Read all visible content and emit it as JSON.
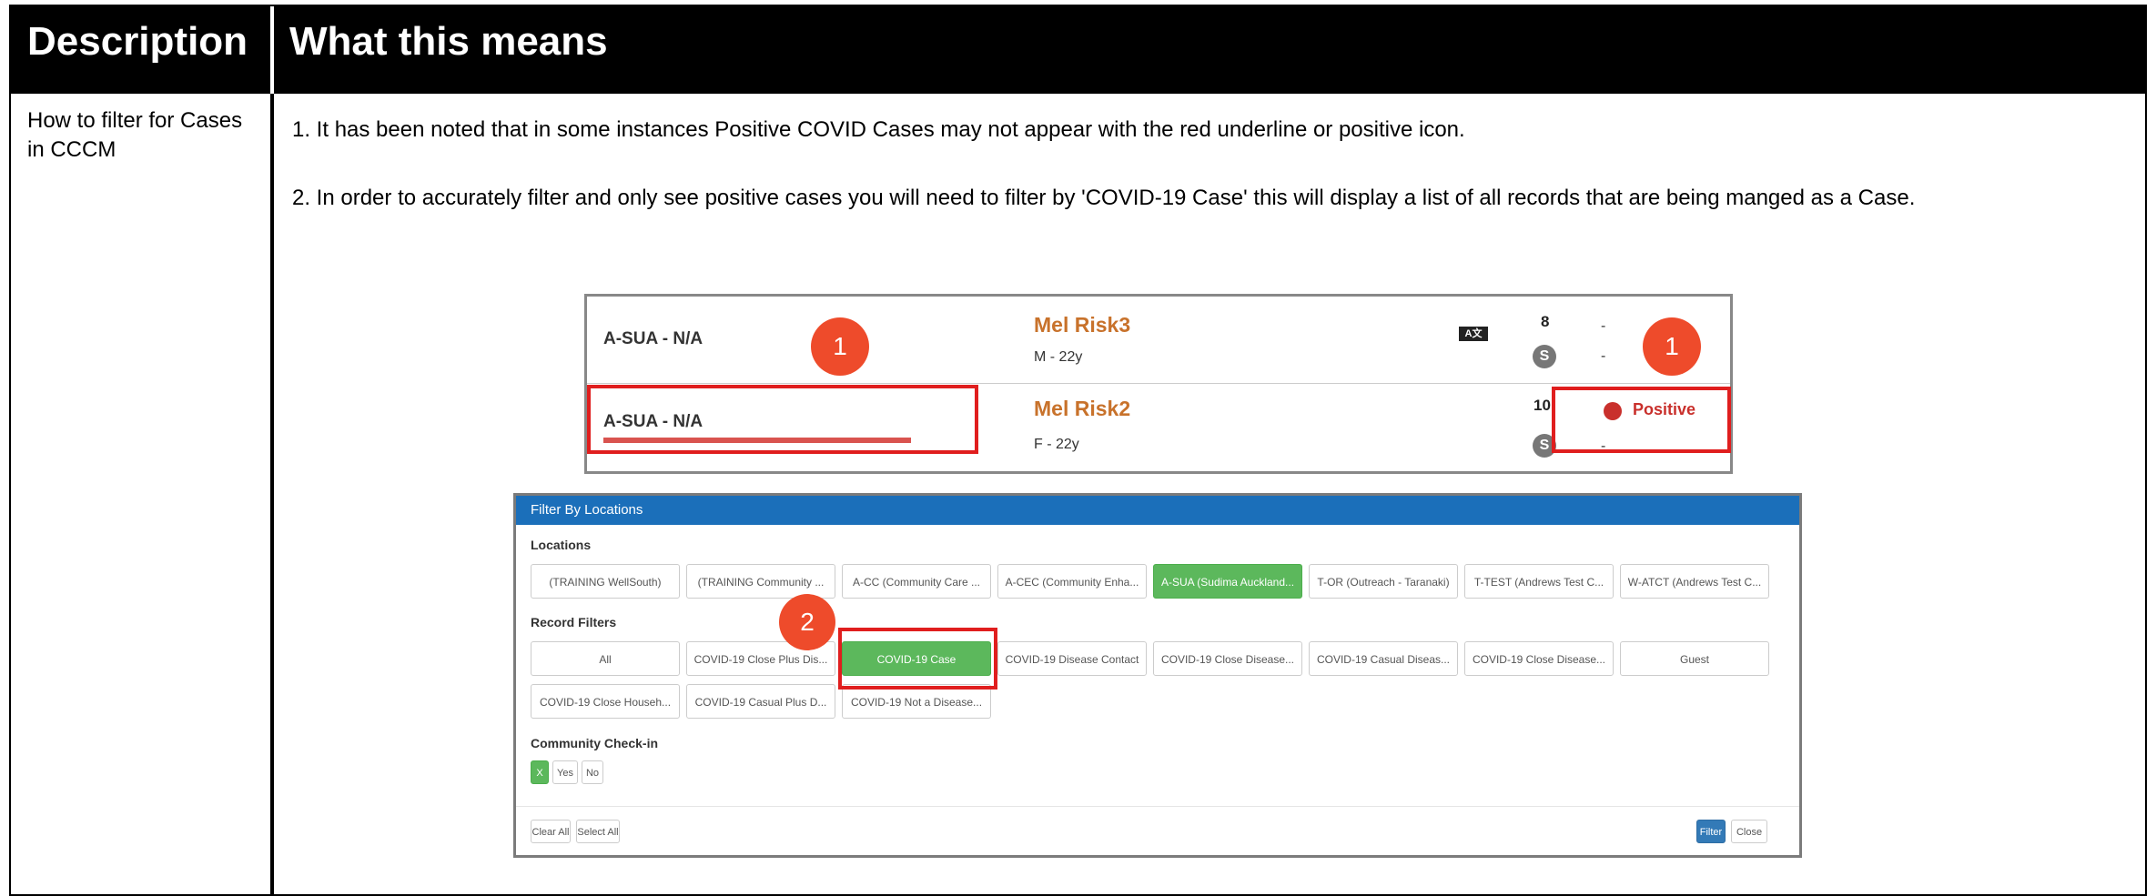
{
  "header": {
    "col1": "Description",
    "col2": "What this means"
  },
  "row": {
    "description": "How to filter for Cases in CCCM",
    "point1": "1. It has been noted that in some instances Positive COVID Cases may not appear with the red underline or positive icon.",
    "point2": "2. In order to accurately filter and only see positive cases you will need to  filter by 'COVID-19 Case'  this will display a list of all records that are being manged as a Case."
  },
  "list_screenshot": {
    "rows": [
      {
        "location": "A-SUA - N/A",
        "name": "Mel Risk3",
        "info": "M - 22y",
        "num": "8",
        "badge": "S",
        "dash1": "-",
        "dash2": "-",
        "lang_icon": "A文"
      },
      {
        "location": "A-SUA - N/A",
        "name": "Mel Risk2",
        "info": "F - 22y",
        "num": "10",
        "badge": "S",
        "status": "Positive",
        "dash2": "-"
      }
    ],
    "markers": [
      "1",
      "1"
    ],
    "colors": {
      "name": "#c8722b",
      "positive": "#c9302c",
      "underline": "#d9534f",
      "highlight": "#e01e1e",
      "marker": "#ee4b2b"
    }
  },
  "filter_dialog": {
    "title": "Filter By Locations",
    "locations_label": "Locations",
    "locations": [
      "(TRAINING WellSouth)",
      "(TRAINING Community ...",
      "A-CC (Community Care ...",
      "A-CEC (Community Enha...",
      "A-SUA (Sudima Auckland...",
      "T-OR (Outreach - Taranaki)",
      "T-TEST (Andrews Test C...",
      "W-ATCT (Andrews Test C..."
    ],
    "selected_location": "A-SUA (Sudima Auckland...",
    "record_filters_label": "Record Filters",
    "record_filters": [
      "All",
      "COVID-19 Close Plus Dis...",
      "COVID-19 Case",
      "COVID-19 Disease Contact",
      "COVID-19 Close Disease...",
      "COVID-19 Casual Diseas...",
      "COVID-19 Close Disease...",
      "Guest",
      "COVID-19 Close Househ...",
      "COVID-19 Casual Plus D...",
      "COVID-19 Not a Disease..."
    ],
    "selected_record_filter": "COVID-19 Case",
    "marker": "2",
    "community_label": "Community Check-in",
    "community_options": [
      "X",
      "Yes",
      "No"
    ],
    "footer": {
      "clear_all": "Clear All",
      "select_all": "Select All",
      "filter": "Filter",
      "close": "Close"
    },
    "colors": {
      "title_bar": "#1b6fba",
      "selected": "#5cb85c",
      "primary": "#337ab7"
    }
  }
}
